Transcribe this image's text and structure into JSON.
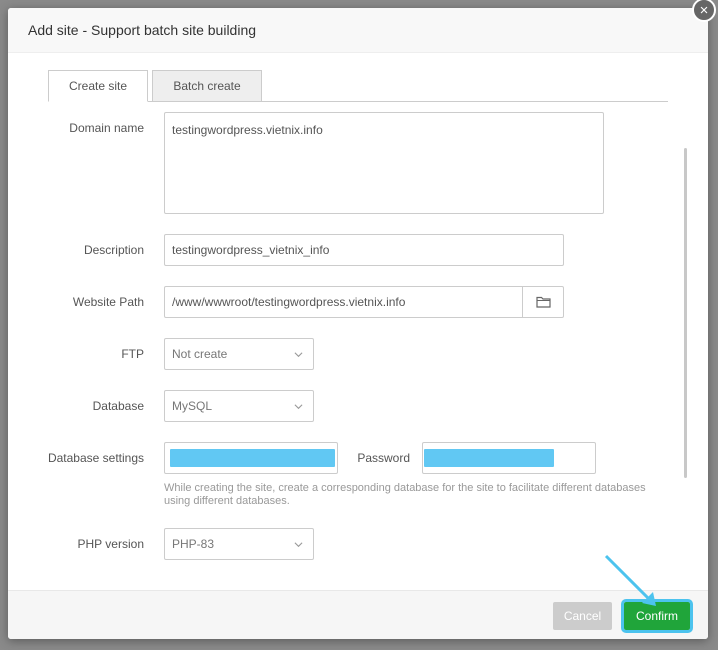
{
  "dialog": {
    "title": "Add site - Support batch site building",
    "close_symbol": "×"
  },
  "tabs": [
    {
      "label": "Create site",
      "active": true
    },
    {
      "label": "Batch create",
      "active": false
    }
  ],
  "form": {
    "domain_name": {
      "label": "Domain name",
      "value": "testingwordpress.vietnix.info"
    },
    "description": {
      "label": "Description",
      "value": "testingwordpress_vietnix_info"
    },
    "website_path": {
      "label": "Website Path",
      "value": "/www/wwwroot/testingwordpress.vietnix.info",
      "icon": "folder-icon"
    },
    "ftp": {
      "label": "FTP",
      "value": "Not create"
    },
    "database": {
      "label": "Database",
      "value": "MySQL"
    },
    "database_settings": {
      "label": "Database settings",
      "password_label": "Password",
      "help": "While creating the site, create a corresponding database for the site to facilitate different databases using different databases."
    },
    "php_version": {
      "label": "PHP version",
      "value": "PHP-83"
    }
  },
  "footer": {
    "cancel_label": "Cancel",
    "confirm_label": "Confirm"
  },
  "colors": {
    "confirm": "#20a53a",
    "highlight": "#4cc3ee",
    "masked": "#61c8f3"
  }
}
